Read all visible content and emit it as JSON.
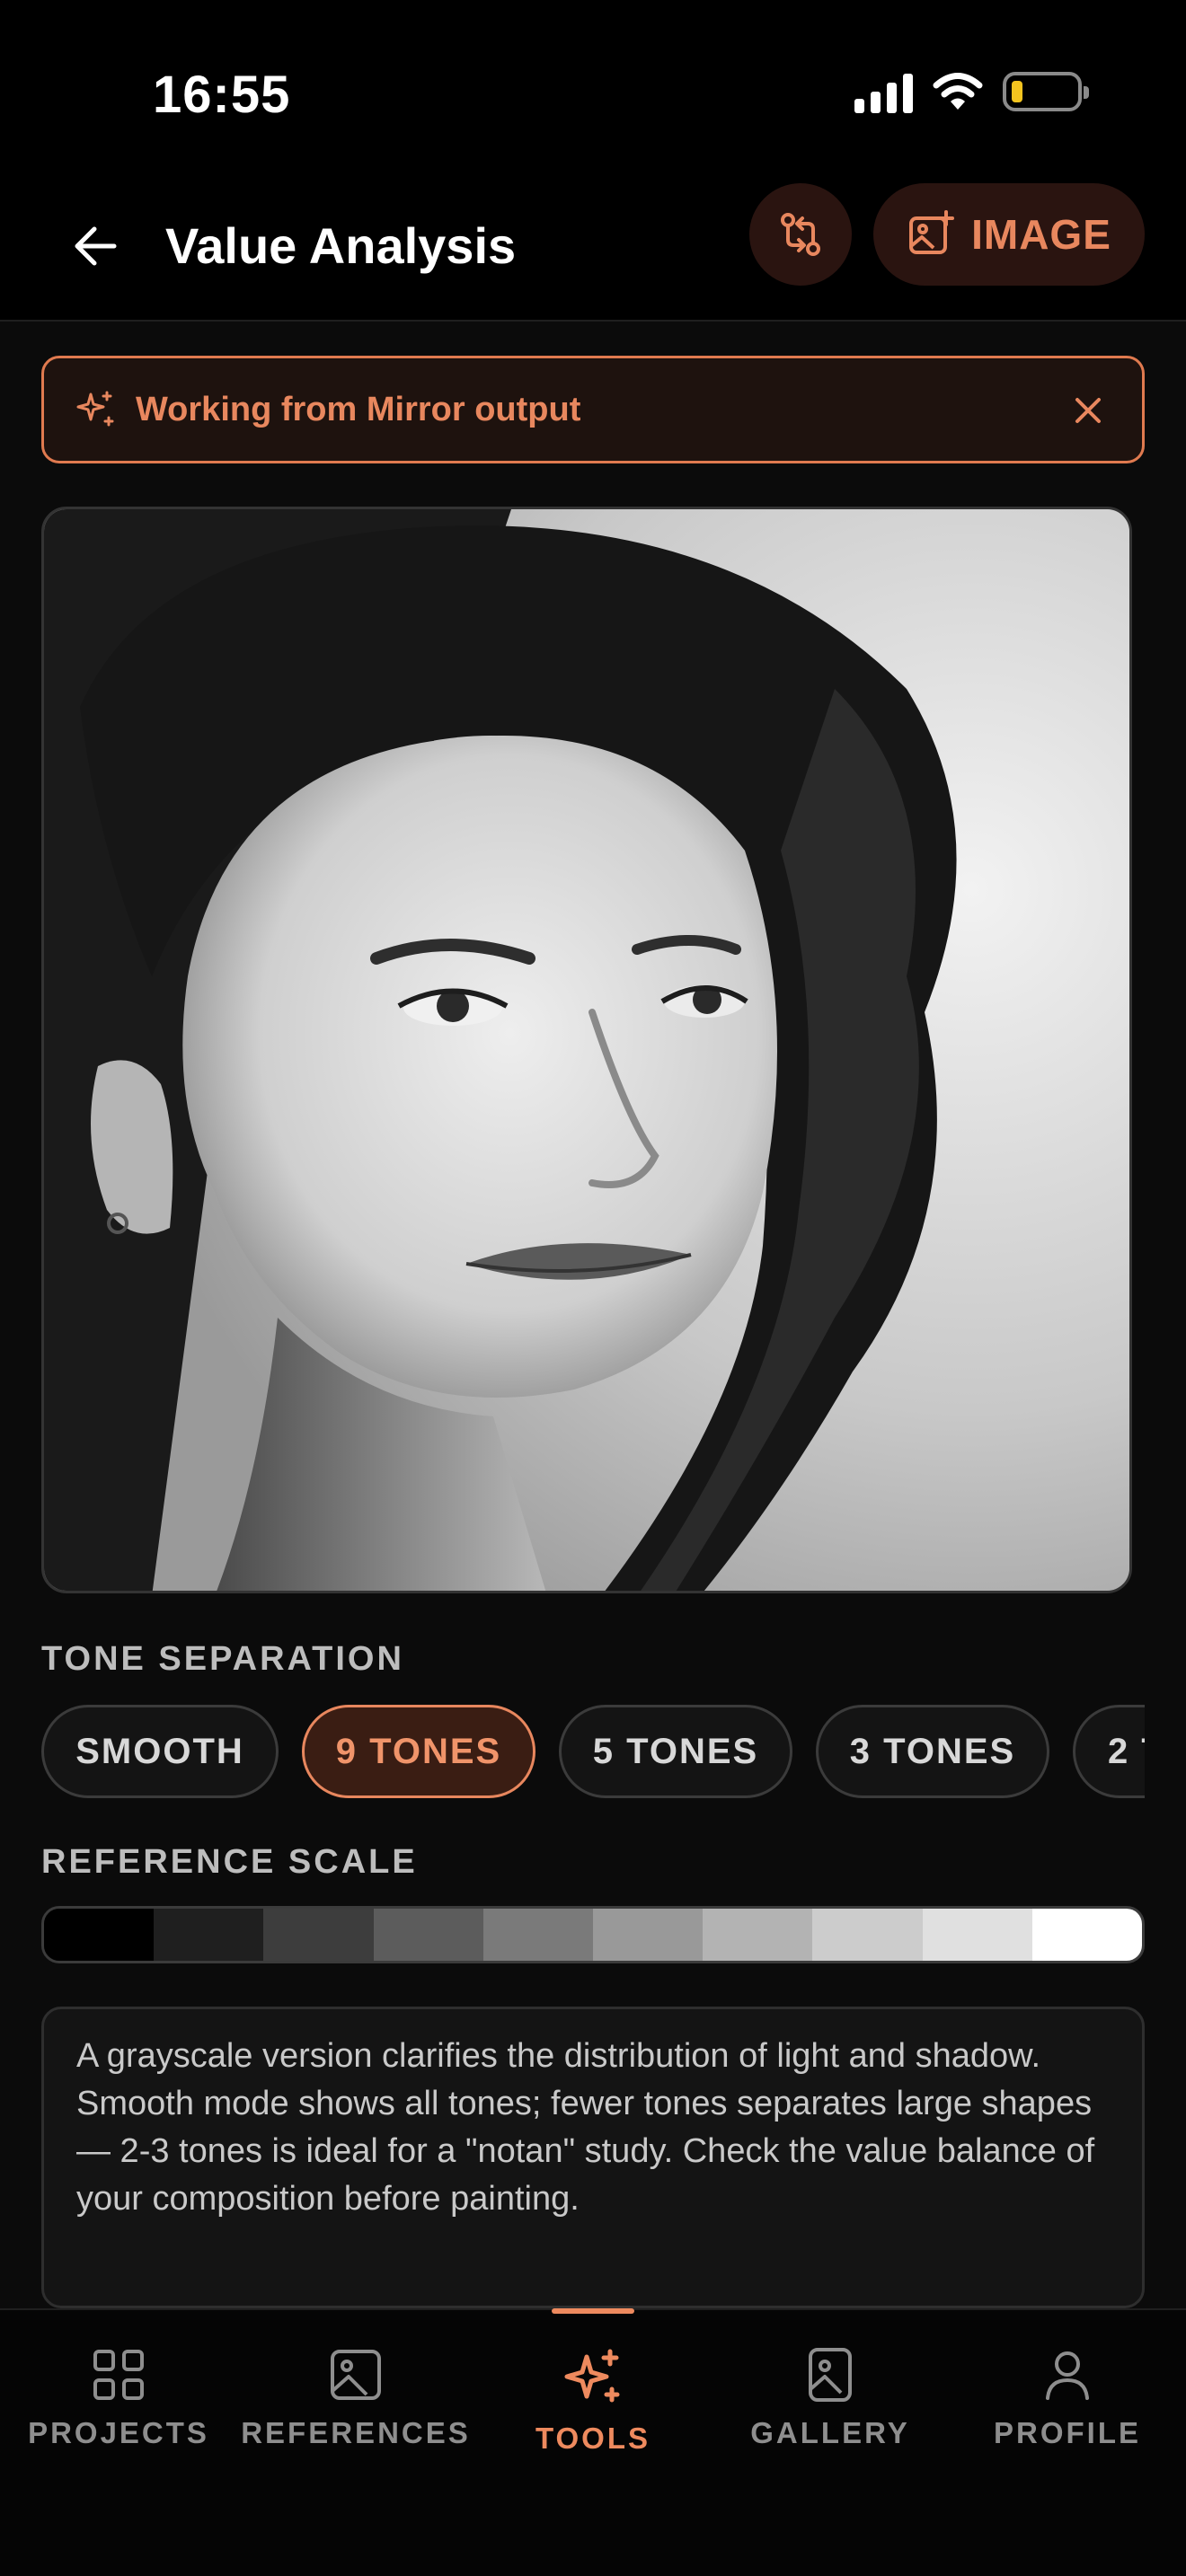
{
  "status_bar": {
    "time": "16:55"
  },
  "header": {
    "title": "Value Analysis",
    "image_button_label": "IMAGE"
  },
  "banner": {
    "text": "Working from Mirror output"
  },
  "tone_separation": {
    "label": "TONE SEPARATION",
    "options": [
      "SMOOTH",
      "9 TONES",
      "5 TONES",
      "3 TONES",
      "2 T"
    ],
    "selected": "9 TONES"
  },
  "reference_scale": {
    "label": "REFERENCE SCALE",
    "swatches": [
      "#000000",
      "#1f1f1f",
      "#3d3d3d",
      "#5c5c5c",
      "#7a7a7a",
      "#999999",
      "#b3b3b3",
      "#cccccc",
      "#e0e0e0",
      "#ffffff"
    ]
  },
  "info": {
    "text": "A grayscale version clarifies the distribution of light and shadow. Smooth mode shows all tones; fewer tones separates large shapes — 2-3 tones is ideal for a \"notan\" study. Check the value balance of your composition before painting."
  },
  "tabbar": {
    "items": [
      {
        "label": "PROJECTS",
        "icon": "grid-icon"
      },
      {
        "label": "REFERENCES",
        "icon": "image-icon"
      },
      {
        "label": "TOOLS",
        "icon": "sparkles-icon"
      },
      {
        "label": "GALLERY",
        "icon": "gallery-icon"
      },
      {
        "label": "PROFILE",
        "icon": "user-icon"
      }
    ],
    "active": "TOOLS"
  },
  "colors": {
    "accent": "#e8875e",
    "background": "#0b0b0b",
    "battery": "#f4c41f"
  }
}
